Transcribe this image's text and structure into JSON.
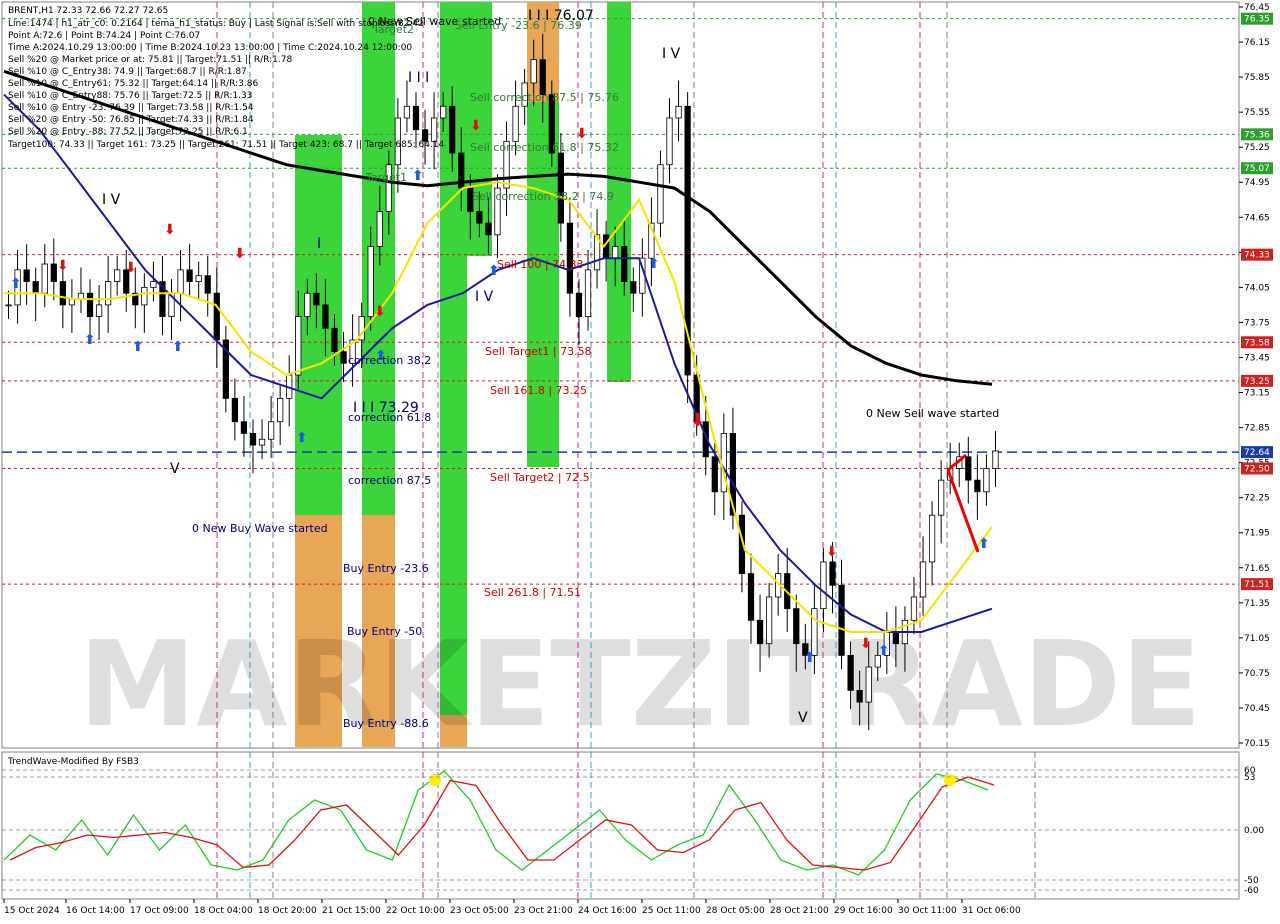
{
  "header": {
    "symbol_line": "BRENT,H1  72.33 72.66 72.27 72.65",
    "info_lines": [
      "Line:1474 | h1_atr_c0: 0.2164 | tema_h1_status: Buy | Last Signal is:Sell with stoploss:82.42",
      "Point A:72.6 | Point B:74.24 | Point C:76.07",
      "Time A:2024.10.29 13:00:00 | Time B:2024.10.23 13:00:00 | Time C:2024.10.24 12:00:00",
      "Sell %20 @ Market price or at: 75.81 || Target:71.51 || R/R:1.78",
      "Sell %10 @ C_Entry38: 74.9 || Target:68.7 || R/R:1.87",
      "Sell %10 @ C_Entry61: 75.32 || Target:64.14 || R/R:3.86",
      "Sell %10 @ C_Entry88: 75.76 || Target:72.5 || R/R:1.33",
      "Sell %10 @ Entry -23: 76.39 || Target:73.58 || R/R:1.54",
      "Sell %20 @ Entry -50: 76.85 || Target:74.33 || R/R:1.84",
      "Sell %20 @ Entry -88: 77.52 || Target:73.25 || R/R:6.1",
      "Target100: 74.33 || Target 161: 73.25 || Target 261: 71.51 || Target 423: 68.7 || Target 685: 64.14"
    ]
  },
  "watermark": "MARKETZITRADE",
  "indicator_label": "TrendWave-Modified By FSB3",
  "annotations": {
    "sell_wave_top": "0 New Sell wave started",
    "sell_entry_top": "Sell Entry -23.6 | 76.39",
    "wave_iii_top": "I I I 76.07",
    "target2": "Target2",
    "target1": "Target1",
    "sell_corr_87": "Sell correction 87.5 | 75.76",
    "sell_corr_61": "Sell correction 61.8 | 75.32",
    "sell_corr_38": "Sell correction 38.2 | 74.9",
    "sell_100": "Sell 100 | 74.33",
    "sell_target1": "Sell Target1 | 73.58",
    "sell_161": "Sell 161.8 | 73.25",
    "sell_target2": "Sell Target2 | 72.5",
    "sell_261": "Sell  261.8 | 71.51",
    "new_sell_wave": "0 New Sell wave started",
    "corr_38": "correction 38.2",
    "corr_61": "correction 61.8",
    "corr_87": "correction 87.5",
    "wave_iii_low": "I I I 73.29",
    "new_buy_wave": "0 New Buy Wave started",
    "buy_entry_23": "Buy Entry -23.6",
    "buy_entry_50": "Buy Entry -50",
    "buy_entry_88": "Buy Entry -88.6",
    "wave_iv_left": "I V",
    "wave_v_left": "V",
    "wave_i": "I",
    "wave_iii": "I I I",
    "wave_iv_mid": "I V",
    "wave_iv_right": "I V",
    "wave_v_right": "V"
  },
  "price_tags": [
    {
      "value": "76.35",
      "color": "#2e9e2e"
    },
    {
      "value": "75.36",
      "color": "#2e9e2e"
    },
    {
      "value": "75.07",
      "color": "#2e9e2e"
    },
    {
      "value": "74.33",
      "color": "#cc2222"
    },
    {
      "value": "73.58",
      "color": "#cc2222"
    },
    {
      "value": "73.25",
      "color": "#cc2222"
    },
    {
      "value": "72.64",
      "color": "#1a3aa8"
    },
    {
      "value": "72.50",
      "color": "#cc2222"
    },
    {
      "value": "71.51",
      "color": "#cc2222"
    }
  ],
  "chart_data": {
    "type": "candlestick",
    "symbol": "BRENT",
    "timeframe": "H1",
    "ohlc_last": {
      "open": 72.33,
      "high": 72.66,
      "low": 72.27,
      "close": 72.65
    },
    "ylim": [
      70.15,
      76.45
    ],
    "y_ticks": [
      "76.45",
      "76.15",
      "75.85",
      "75.55",
      "75.25",
      "74.95",
      "74.65",
      "74.35",
      "74.05",
      "73.75",
      "73.45",
      "73.15",
      "72.85",
      "72.55",
      "72.25",
      "71.95",
      "71.65",
      "71.35",
      "71.05",
      "70.75",
      "70.45",
      "70.15"
    ],
    "x_labels": [
      "15 Oct 2024",
      "16 Oct 14:00",
      "17 Oct 09:00",
      "18 Oct 04:00",
      "18 Oct 20:00",
      "21 Oct 15:00",
      "22 Oct 10:00",
      "23 Oct 05:00",
      "23 Oct 21:00",
      "24 Oct 16:00",
      "25 Oct 11:00",
      "28 Oct 05:00",
      "28 Oct 21:00",
      "29 Oct 16:00",
      "30 Oct 11:00",
      "31 Oct 06:00"
    ],
    "levels": [
      {
        "name": "Sell Entry -23.6",
        "value": 76.35,
        "color": "#2e9e2e"
      },
      {
        "name": "Sell correction 61.8",
        "value": 75.36,
        "color": "#2e9e2e"
      },
      {
        "name": "Sell correction 38.2",
        "value": 75.07,
        "color": "#2e9e2e"
      },
      {
        "name": "Sell 100",
        "value": 74.33,
        "color": "#cc2222"
      },
      {
        "name": "Sell Target1",
        "value": 73.58,
        "color": "#cc2222"
      },
      {
        "name": "Sell 161.8",
        "value": 73.25,
        "color": "#cc2222"
      },
      {
        "name": "Bid",
        "value": 72.64,
        "color": "#1a3aa8"
      },
      {
        "name": "Sell Target2",
        "value": 72.5,
        "color": "#cc2222"
      },
      {
        "name": "Sell 261.8",
        "value": 71.51,
        "color": "#cc2222"
      }
    ],
    "close_path": [
      73.9,
      74.2,
      74.1,
      74.0,
      74.25,
      74.1,
      73.9,
      73.95,
      74.0,
      73.8,
      73.9,
      74.1,
      74.2,
      74.0,
      73.9,
      74.05,
      74.1,
      73.8,
      74.0,
      74.2,
      74.1,
      74.15,
      74.0,
      73.6,
      73.1,
      72.9,
      72.8,
      72.7,
      72.75,
      72.9,
      73.1,
      73.3,
      73.8,
      74.0,
      73.9,
      73.7,
      73.5,
      73.4,
      73.6,
      73.8,
      74.4,
      74.7,
      75.1,
      75.5,
      75.6,
      75.4,
      75.3,
      75.5,
      75.6,
      75.2,
      74.9,
      74.7,
      74.6,
      74.5,
      74.9,
      75.3,
      75.6,
      75.8,
      76.0,
      75.7,
      75.2,
      74.6,
      74.0,
      73.8,
      74.2,
      74.5,
      74.3,
      74.4,
      74.1,
      74.0,
      74.3,
      74.6,
      75.1,
      75.5,
      75.6,
      73.3,
      72.9,
      72.6,
      72.3,
      72.8,
      72.1,
      71.6,
      71.2,
      71.0,
      71.4,
      71.6,
      71.3,
      71.0,
      70.9,
      71.3,
      71.7,
      71.5,
      70.9,
      70.6,
      70.5,
      70.8,
      70.9,
      71.1,
      71.0,
      71.2,
      71.4,
      71.7,
      72.1,
      72.4,
      72.5,
      72.6,
      72.4,
      72.3,
      72.5,
      72.65
    ],
    "moving_averages": [
      {
        "color": "#000000",
        "values": [
          75.9,
          75.8,
          75.7,
          75.6,
          75.5,
          75.4,
          75.3,
          75.2,
          75.1,
          75.05,
          75.0,
          74.95,
          74.92,
          74.95,
          74.98,
          75.0,
          75.02,
          75.0,
          74.95,
          74.9,
          74.7,
          74.4,
          74.1,
          73.8,
          73.55,
          73.4,
          73.3,
          73.25,
          73.22
        ]
      },
      {
        "color": "#1a1aa0",
        "values": [
          75.7,
          75.4,
          75.0,
          74.6,
          74.2,
          73.9,
          73.6,
          73.3,
          73.2,
          73.1,
          73.4,
          73.7,
          73.9,
          74.0,
          74.2,
          74.3,
          74.2,
          74.3,
          74.3,
          73.4,
          72.7,
          72.2,
          71.8,
          71.5,
          71.25,
          71.1,
          71.1,
          71.2,
          71.3
        ]
      },
      {
        "color": "#f2e600",
        "values": [
          74.0,
          74.0,
          73.95,
          73.95,
          74.0,
          74.0,
          73.9,
          73.5,
          73.3,
          73.4,
          73.6,
          74.0,
          74.6,
          74.9,
          74.95,
          74.9,
          74.8,
          74.4,
          74.8,
          74.1,
          72.9,
          71.8,
          71.5,
          71.2,
          71.1,
          71.1,
          71.2,
          71.6,
          72.0
        ]
      }
    ],
    "oscillator": {
      "name": "TrendWave-Modified By FSB3",
      "ylim": [
        -60,
        60
      ],
      "y_ticks": [
        "60",
        "53",
        "0.00",
        "-50",
        "-60"
      ],
      "values": [
        -30,
        -5,
        -20,
        10,
        -25,
        15,
        -20,
        5,
        -35,
        -40,
        -30,
        10,
        30,
        20,
        -20,
        -30,
        40,
        59,
        30,
        -20,
        -40,
        -20,
        0,
        20,
        -10,
        -30,
        -15,
        -5,
        45,
        10,
        -30,
        -40,
        -35,
        -45,
        -20,
        30,
        56,
        50,
        40
      ]
    }
  }
}
